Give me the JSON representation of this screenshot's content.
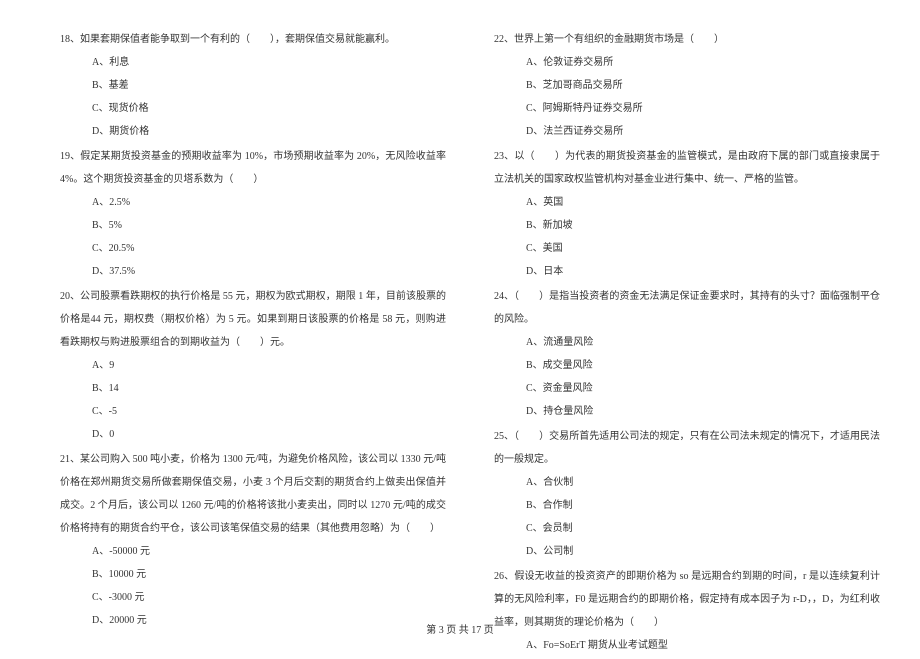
{
  "left": {
    "q18": {
      "text": "18、如果套期保值者能争取到一个有利的（　　），套期保值交易就能赢利。",
      "a": "A、利息",
      "b": "B、基差",
      "c": "C、现货价格",
      "d": "D、期货价格"
    },
    "q19": {
      "text": "19、假定某期货投资基金的预期收益率为 10%，市场预期收益率为 20%，无风险收益率 4%。这个期货投资基金的贝塔系数为（　　）",
      "a": "A、2.5%",
      "b": "B、5%",
      "c": "C、20.5%",
      "d": "D、37.5%"
    },
    "q20": {
      "text": "20、公司股票看跌期权的执行价格是 55 元，期权为欧式期权，期限 1 年，目前该股票的价格是44 元，期权费（期权价格）为 5 元。如果到期日该股票的价格是 58 元，则购进看跌期权与购进股票组合的到期收益为（　　）元。",
      "a": "A、9",
      "b": "B、14",
      "c": "C、-5",
      "d": "D、0"
    },
    "q21": {
      "text": "21、某公司购入 500 吨小麦，价格为 1300 元/吨，为避免价格风险，该公司以 1330 元/吨价格在郑州期货交易所做套期保值交易，小麦 3 个月后交割的期货合约上做卖出保值并成交。2 个月后，该公司以 1260 元/吨的价格将该批小麦卖出，同时以 1270 元/吨的成交价格将持有的期货合约平仓，该公司该笔保值交易的结果（其他费用忽略）为（　　）",
      "a": "A、-50000 元",
      "b": "B、10000 元",
      "c": "C、-3000 元",
      "d": "D、20000 元"
    }
  },
  "right": {
    "q22": {
      "text": "22、世界上第一个有组织的金融期货市场是（　　）",
      "a": "A、伦敦证券交易所",
      "b": "B、芝加哥商品交易所",
      "c": "C、阿姆斯特丹证券交易所",
      "d": "D、法兰西证券交易所"
    },
    "q23": {
      "text": "23、以（　　）为代表的期货投资基金的监管模式，是由政府下属的部门或直接隶属于立法机关的国家政权监管机构对基金业进行集中、统一、严格的监管。",
      "a": "A、英国",
      "b": "B、新加坡",
      "c": "C、美国",
      "d": "D、日本"
    },
    "q24": {
      "text": "24、（　　）是指当投资者的资金无法满足保证金要求时，其持有的头寸？面临强制平仓的风险。",
      "a": "A、流通量风险",
      "b": "B、成交量风险",
      "c": "C、资金量风险",
      "d": "D、持仓量风险"
    },
    "q25": {
      "text": "25、（　　）交易所首先适用公司法的规定，只有在公司法未规定的情况下，才适用民法的一般规定。",
      "a": "A、合伙制",
      "b": "B、合作制",
      "c": "C、会员制",
      "d": "D、公司制"
    },
    "q26": {
      "text": "26、假设无收益的投资资产的即期价格为 so 是远期合约到期的时间，r 是以连续复利计算的无风险利率，F0 是远期合约的即期价格，假定持有成本因子为 r-D，，D，为红利收益率，则其期货的理论价格为（　　）",
      "a": "A、Fo=SoErT 期货从业考试题型"
    }
  },
  "footer": "第 3 页 共 17 页"
}
